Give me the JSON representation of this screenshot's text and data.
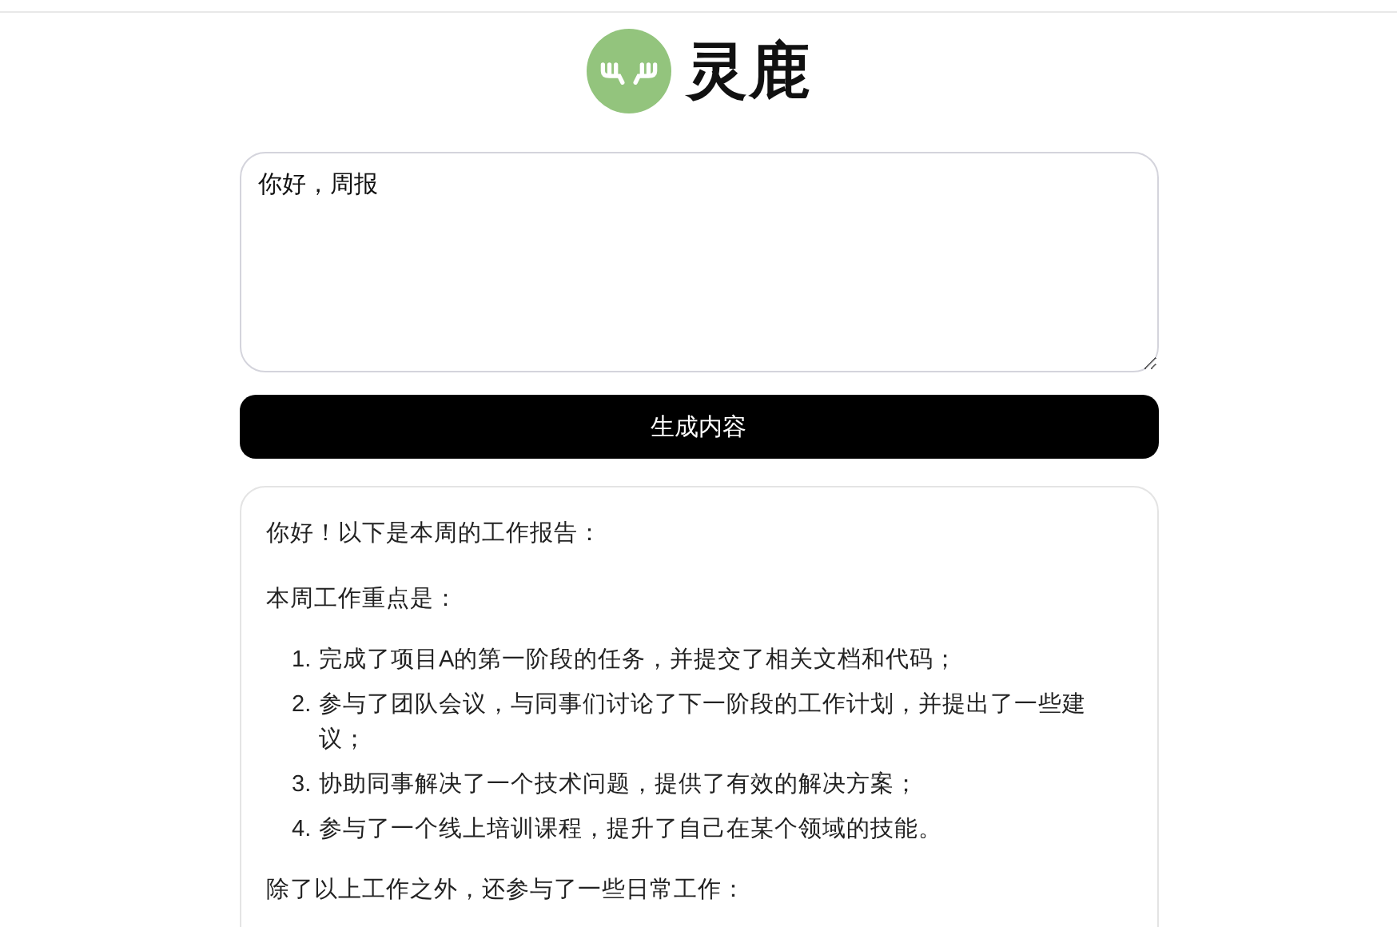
{
  "logo": {
    "name": "灵鹿"
  },
  "prompt": {
    "value": "你好，周报"
  },
  "generate_button": {
    "label": "生成内容"
  },
  "result": {
    "blocks": [
      {
        "kind": "paragraph",
        "text": "你好！以下是本周的工作报告："
      },
      {
        "kind": "paragraph",
        "text": "本周工作重点是："
      },
      {
        "kind": "list",
        "items": [
          {
            "number": "1.",
            "text": "完成了项目A的第一阶段的任务，并提交了相关文档和代码；"
          },
          {
            "number": "2.",
            "text": "参与了团队会议，与同事们讨论了下一阶段的工作计划，并提出了一些建议；"
          },
          {
            "number": "3.",
            "text": "协助同事解决了一个技术问题，提供了有效的解决方案；"
          },
          {
            "number": "4.",
            "text": "参与了一个线上培训课程，提升了自己在某个领域的技能。"
          }
        ]
      },
      {
        "kind": "paragraph",
        "text": "除了以上工作之外，还参与了一些日常工作："
      }
    ]
  }
}
